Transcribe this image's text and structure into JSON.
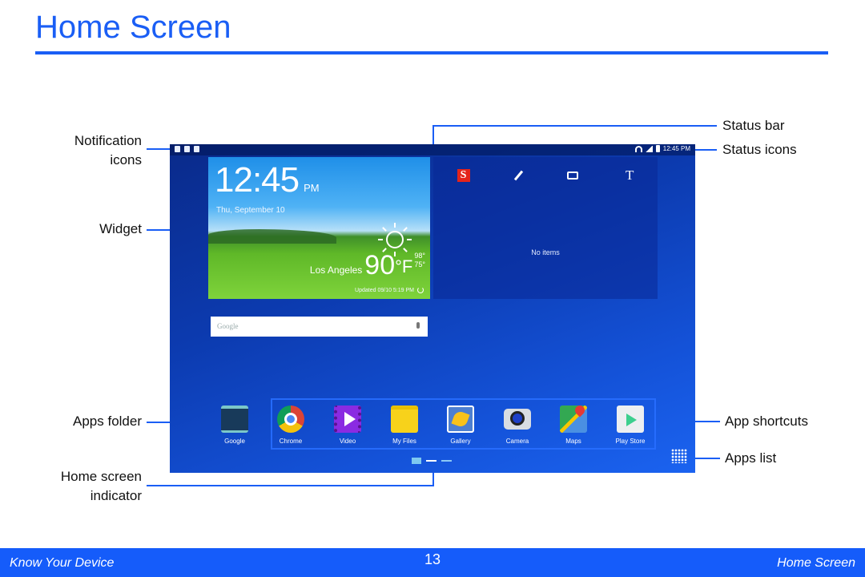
{
  "page": {
    "title": "Home Screen",
    "accent_color": "#1a5ef5"
  },
  "callouts": {
    "notification_icons": [
      "Notification",
      "icons"
    ],
    "widget": "Widget",
    "apps_folder": "Apps folder",
    "home_screen_indicator": [
      "Home screen",
      "indicator"
    ],
    "status_bar": "Status bar",
    "status_icons": "Status icons",
    "app_shortcuts": "App shortcuts",
    "apps_list": "Apps list"
  },
  "device": {
    "statusbar": {
      "notification_icons": [
        "download-icon",
        "task-icon",
        "lock-warning-icon"
      ],
      "status_icons": [
        "wifi-icon",
        "signal-icon",
        "battery-icon"
      ],
      "time": "12:45 PM"
    },
    "widget": {
      "time": "12:45",
      "ampm": "PM",
      "date": "Thu, September 10",
      "city": "Los Angeles",
      "temperature": "90",
      "unit": "°F",
      "high": "98°",
      "low": "75°",
      "updated": "Updated 09/10 5:19 PM",
      "weather_icon": "sun-icon"
    },
    "scrapbook": {
      "tools": [
        "scrapbook-s-icon",
        "pen-icon",
        "camera-capture-icon",
        "text-icon"
      ],
      "text_tool_label": "T",
      "s_label": "S",
      "empty_text": "No items"
    },
    "search": {
      "placeholder": "Google"
    },
    "apps_folder": {
      "label": "Google"
    },
    "shortcuts": [
      {
        "label": "Chrome",
        "icon": "chrome-icon"
      },
      {
        "label": "Video",
        "icon": "video-icon"
      },
      {
        "label": "My Files",
        "icon": "my-files-icon"
      },
      {
        "label": "Gallery",
        "icon": "gallery-icon"
      },
      {
        "label": "Camera",
        "icon": "camera-icon"
      },
      {
        "label": "Maps",
        "icon": "maps-icon"
      },
      {
        "label": "Play Store",
        "icon": "play-store-icon"
      }
    ],
    "home_indicator": {
      "pages": 2,
      "active_page": 1
    }
  },
  "footer": {
    "left": "Know Your Device",
    "page_number": "13",
    "right": "Home Screen",
    "background": "#155cfa"
  }
}
